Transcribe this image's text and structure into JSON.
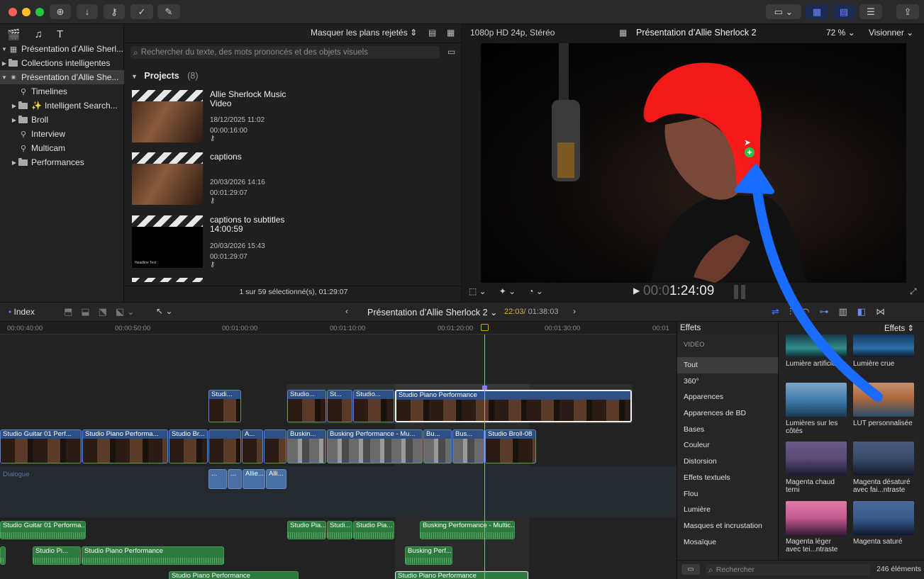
{
  "toolbar": {
    "view_options": "Masquer les plans rejetés",
    "format": "1080p HD 24p, Stéréo",
    "viewer_title": "Présentation d’Allie Sherlock 2",
    "zoom": "72 %",
    "view_menu": "Visionner"
  },
  "sidebar": {
    "items": [
      {
        "label": "Présentation d’Allie Sherl..."
      },
      {
        "label": "Collections intelligentes"
      },
      {
        "label": "Présentation d’Allie She..."
      },
      {
        "label": "Timelines"
      },
      {
        "label": "Intelligent Search..."
      },
      {
        "label": "Broll"
      },
      {
        "label": "Interview"
      },
      {
        "label": "Multicam"
      },
      {
        "label": "Performances"
      }
    ]
  },
  "browser": {
    "search_placeholder": "Rechercher du texte, des mots prononcés et des objets visuels",
    "section_title": "Projects",
    "section_count": "(8)",
    "projects": [
      {
        "title": "Allie Sherlock Music Video",
        "date": "18/12/2025 11:02",
        "duration": "00:00:16:00"
      },
      {
        "title": "captions",
        "date": "20/03/2026 14:16",
        "duration": "00:01:29:07"
      },
      {
        "title": "captions to subtitles 14:00:59",
        "date": "20/03/2026 15:43",
        "duration": "00:01:29:07",
        "thumb_text": "Headline Text"
      }
    ],
    "status": "1 sur 59 sélectionné(s), 01:29:07"
  },
  "viewer": {
    "timecode_dim": "00:0",
    "timecode": "1:24:09"
  },
  "timeline": {
    "index_label": "Index",
    "title": "Présentation d’Allie Sherlock 2",
    "position": "22:03",
    "total": "/ 01:38:03",
    "ruler": [
      "00:00:40:00",
      "00:00:50:00",
      "00:01:00:00",
      "00:01:10:00",
      "00:01:20:00",
      "00:01:30:00",
      "00:01"
    ],
    "dialogue_label": "Dialogue",
    "connected_clips": [
      {
        "label": "Studi..."
      },
      {
        "label": "Studio..."
      },
      {
        "label": "St..."
      },
      {
        "label": "Studio..."
      },
      {
        "label": "Studio Piano Performance"
      }
    ],
    "primary_clips": [
      {
        "label": "Studio Guitar 01 Perf..."
      },
      {
        "label": "Studio Piano Performa..."
      },
      {
        "label": "Studio Br..."
      },
      {
        "label": "A..."
      },
      {
        "label": "Buskin..."
      },
      {
        "label": "Busking Performance - Mu..."
      },
      {
        "label": "Bu..."
      },
      {
        "label": "Bus..."
      },
      {
        "label": "Studio Broll-08"
      }
    ],
    "dialogue_clips": [
      {
        "label": "..."
      },
      {
        "label": "..."
      },
      {
        "label": "Allie..."
      },
      {
        "label": "Alli..."
      }
    ],
    "audio_clips": [
      {
        "label": "Studio Guitar 01 Performa..."
      },
      {
        "label": "Studio Pia..."
      },
      {
        "label": "Studi..."
      },
      {
        "label": "Studio Pia..."
      },
      {
        "label": "Busking Performance - Multic..."
      },
      {
        "label": "Studio Pi..."
      },
      {
        "label": "Studio Piano Performance"
      },
      {
        "label": "Busking Perf..."
      },
      {
        "label": "Studio Piano Performance"
      },
      {
        "label": "Studio Piano Performance"
      }
    ]
  },
  "effects": {
    "title": "Effets",
    "menu": "Effets",
    "section": "VIDÉO",
    "categories": [
      "Tout",
      "360°",
      "Apparences",
      "Apparences de BD",
      "Bases",
      "Couleur",
      "Distorsion",
      "Effets textuels",
      "Flou",
      "Lumière",
      "Masques et incrustation",
      "Mosaïque"
    ],
    "items": [
      {
        "name": "Lumière artificielle",
        "color": "#2f8c8c"
      },
      {
        "name": "Lumière crue",
        "color": "#2a6fa6"
      },
      {
        "name": "Lumières sur les côtés",
        "color": "#3a78a8"
      },
      {
        "name": "LUT personnalisée",
        "color": "#b0683a"
      },
      {
        "name": "Magenta chaud terni",
        "color": "#5a4a78"
      },
      {
        "name": "Magenta désaturé avec fai...ntraste",
        "color": "#3a4a6a"
      },
      {
        "name": "Magenta léger avec tei...ntraste",
        "color": "#c25a8c"
      },
      {
        "name": "Magenta saturé",
        "color": "#3a5a8a"
      }
    ],
    "search_placeholder": "Rechercher",
    "count": "246 éléments"
  },
  "colors": {
    "accent": "#1a6cff",
    "mask": "#ff1a1a",
    "video_clip": "#3a5f9a",
    "audio_clip": "#2f7a3e",
    "playhead": "#d7a516"
  }
}
